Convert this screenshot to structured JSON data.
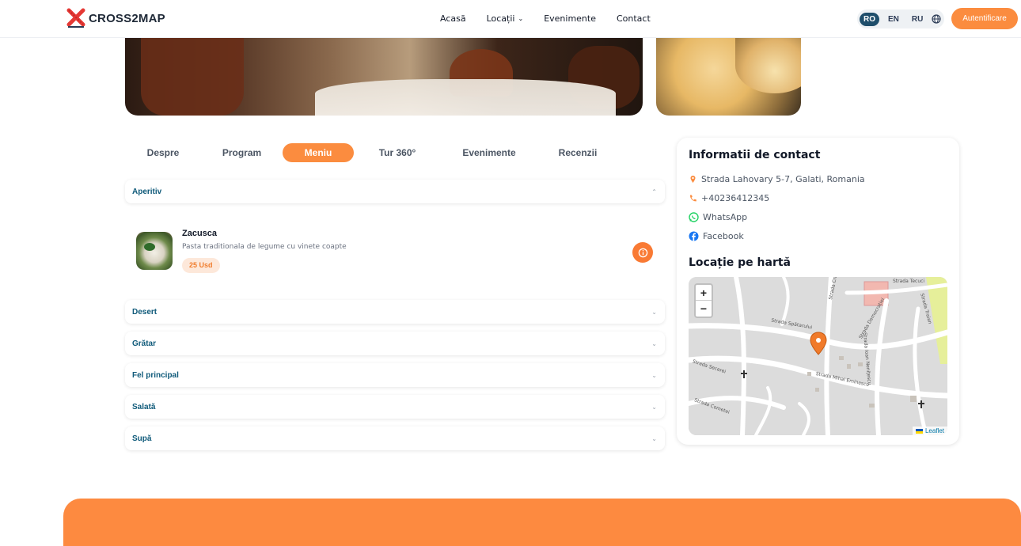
{
  "brand": {
    "name": "CROSS2MAP",
    "accent": "#fb8c3f"
  },
  "nav": {
    "home": "Acasă",
    "locations": "Locații",
    "events": "Evenimente",
    "contact": "Contact"
  },
  "languages": [
    "RO",
    "EN",
    "RU"
  ],
  "active_language": "RO",
  "login_label": "Autentificare",
  "tabs": [
    "Despre",
    "Program",
    "Meniu",
    "Tur 360°",
    "Evenimente",
    "Recenzii"
  ],
  "active_tab": "Meniu",
  "menu": {
    "open_category": "Aperitiv",
    "item": {
      "name": "Zacusca",
      "description": "Pasta traditionala de legume cu vinete coapte",
      "price": "25 Usd"
    },
    "categories": [
      "Desert",
      "Grătar",
      "Fel principal",
      "Salată",
      "Supă"
    ]
  },
  "contact": {
    "title": "Informatii de contact",
    "address": "Strada Lahovary 5-7, Galati, Romania",
    "phone": "+40236412345",
    "whatsapp": "WhatsApp",
    "facebook": "Facebook"
  },
  "map": {
    "title": "Locație pe hartă",
    "zoom_in": "+",
    "zoom_out": "−",
    "attribution": "Leaflet",
    "labels": [
      "Strada Tecuci",
      "Strada Traian",
      "Strada Spătarului",
      "Strada Cristofor Columb",
      "Strada Democrației",
      "Strada Mihai Eminescu",
      "Strada Secerei",
      "Strada Cometei",
      "Strada Ioan Nenițescu"
    ]
  }
}
